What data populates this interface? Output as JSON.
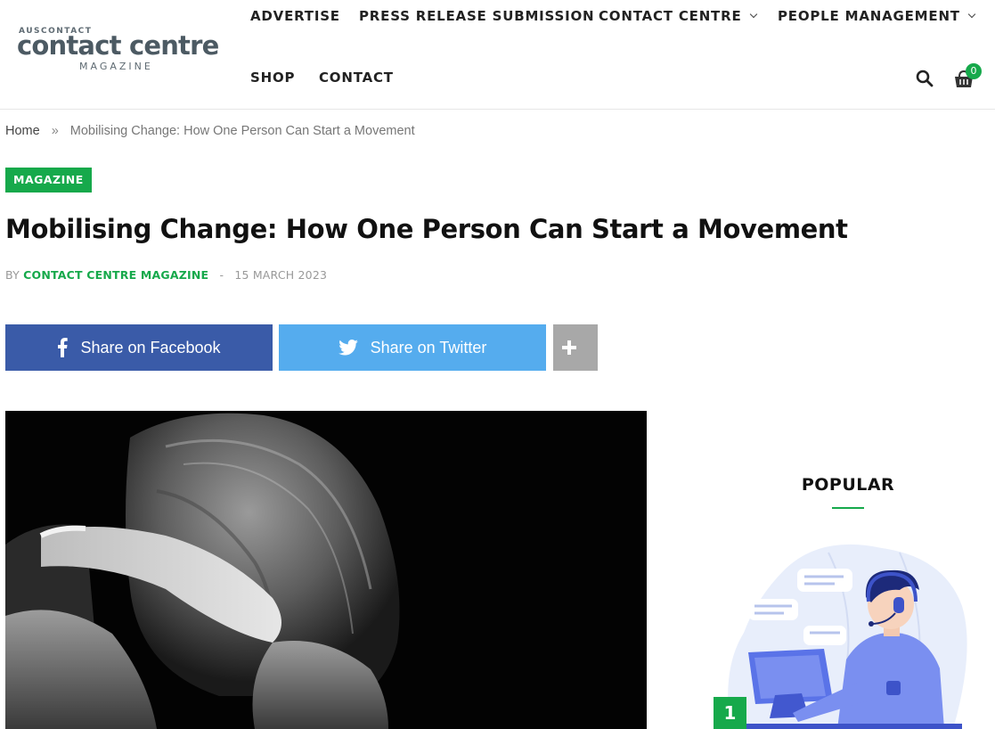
{
  "logo": {
    "top": "AUSCONTACT",
    "main": "contact centre",
    "sub": "MAGAZINE"
  },
  "nav": {
    "advertise": "ADVERTISE",
    "press_release": "PRESS RELEASE SUBMISSION",
    "contact_centre": "CONTACT CENTRE",
    "people_management": "PEOPLE MANAGEMENT",
    "shop": "SHOP",
    "contact": "CONTACT"
  },
  "cart": {
    "count": "0"
  },
  "breadcrumb": {
    "home": "Home",
    "separator": "»",
    "current": "Mobilising Change: How One Person Can Start a Movement"
  },
  "post": {
    "category": "MAGAZINE",
    "title": "Mobilising Change: How One Person Can Start a Movement",
    "by": "BY",
    "author": "CONTACT CENTRE MAGAZINE",
    "dash": "-",
    "date": "15 MARCH 2023"
  },
  "share": {
    "facebook": "Share on Facebook",
    "twitter": "Share on Twitter"
  },
  "sidebar": {
    "title": "POPULAR",
    "items": [
      {
        "rank": "1"
      }
    ]
  },
  "colors": {
    "accent_green": "#16a94b",
    "facebook_blue": "#3a5ba8",
    "twitter_blue": "#55acee",
    "more_grey": "#a8a8a8"
  },
  "icons": [
    "search-icon",
    "shopping-cart-icon",
    "facebook-icon",
    "twitter-icon",
    "plus-icon",
    "chevron-down-icon"
  ]
}
